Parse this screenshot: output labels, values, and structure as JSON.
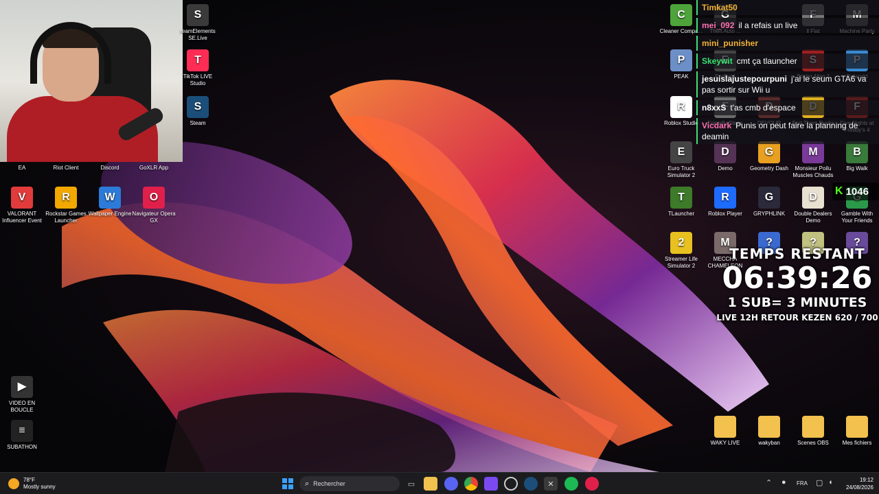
{
  "desktop_left": [
    {
      "label": "EA",
      "color": "#f0f0f0",
      "glyph": ""
    },
    {
      "label": "Riot Client",
      "color": "#f0f0f0",
      "glyph": ""
    },
    {
      "label": "Discord",
      "color": "#f0f0f0",
      "glyph": ""
    },
    {
      "label": "GoXLR App",
      "color": "#f0f0f0",
      "glyph": ""
    },
    {
      "label": "VALORANT Influencer Event",
      "color": "#e23b3b",
      "glyph": "V"
    },
    {
      "label": "Rockstar Games Launcher",
      "color": "#f2a800",
      "glyph": "R"
    },
    {
      "label": "Wallpaper Engine",
      "color": "#2c7bd9",
      "glyph": "W"
    },
    {
      "label": "Navigateur Opera GX",
      "color": "#e0204a",
      "glyph": "O"
    },
    {
      "label": "reamElements SE.Live",
      "color": "#3a3a3a",
      "glyph": "S"
    },
    {
      "label": "TikTok LIVE Studio",
      "color": "#ff2d55",
      "glyph": "T"
    },
    {
      "label": "Steam",
      "color": "#1b4f79",
      "glyph": "S"
    },
    {
      "label": "VIDEO EN BOUCLE",
      "color": "#333333",
      "glyph": "▶"
    },
    {
      "label": "SUBATHON",
      "color": "#222222",
      "glyph": "≡"
    }
  ],
  "desktop_right": [
    {
      "label": "Cleaner Compa...",
      "color": "#4ea43a",
      "glyph": "C"
    },
    {
      "label": "Theft Auto ...",
      "color": "#333333",
      "glyph": "G"
    },
    {
      "label": "ll Flat",
      "color": "#777777",
      "glyph": "F"
    },
    {
      "label": "Machine Party",
      "color": "#5a5a5a",
      "glyph": "M"
    },
    {
      "label": "PEAK",
      "color": "#6d8fc8",
      "glyph": "P"
    },
    {
      "label": "Endfield",
      "color": "#444444",
      "glyph": "E"
    },
    {
      "label": "Spider-Man 2",
      "color": "#a02020",
      "glyph": "S"
    },
    {
      "label": "Palworld",
      "color": "#3a8ad0",
      "glyph": "P"
    },
    {
      "label": "Roblox Studio",
      "color": "#ffffff",
      "glyph": "R"
    },
    {
      "label": "Friendly Steps",
      "color": "#6b6b6b",
      "glyph": "F"
    },
    {
      "label": "DEVOUR",
      "color": "#5a2a2a",
      "glyph": "D"
    },
    {
      "label": "Sort Them Ducks",
      "color": "#e0b020",
      "glyph": "D"
    },
    {
      "label": "Five Nights at Freddy's 4",
      "color": "#5a1a1a",
      "glyph": "F"
    },
    {
      "label": "Euro Truck Simulator 2",
      "color": "#444444",
      "glyph": "E"
    },
    {
      "label": "Demo",
      "color": "#553355",
      "glyph": "D"
    },
    {
      "label": "Geometry Dash",
      "color": "#e8a020",
      "glyph": "G"
    },
    {
      "label": "Monsieur Poilu Muscles Chauds",
      "color": "#7a3a9a",
      "glyph": "M"
    },
    {
      "label": "Big Walk",
      "color": "#3a7a3a",
      "glyph": "B"
    },
    {
      "label": "TLauncher",
      "color": "#3d7a2a",
      "glyph": "T"
    },
    {
      "label": "Roblox Player",
      "color": "#1e6bff",
      "glyph": "R"
    },
    {
      "label": "GRYPHLINK",
      "color": "#2a2a3a",
      "glyph": "G"
    },
    {
      "label": "Double Dealers Demo",
      "color": "#e8e0d0",
      "glyph": "D"
    },
    {
      "label": "Gamble With Your Friends",
      "color": "#2a9a4a",
      "glyph": "G"
    },
    {
      "label": "Streamer Life Simulator 2",
      "color": "#e8c020",
      "glyph": "2"
    },
    {
      "label": "MECCHA CHAMELEON",
      "color": "#7a6a6a",
      "glyph": "M"
    },
    {
      "label": "",
      "color": "#3a6ad0",
      "glyph": "?"
    },
    {
      "label": "",
      "color": "#c0c080",
      "glyph": "?"
    },
    {
      "label": "",
      "color": "#6a4a9a",
      "glyph": "?"
    }
  ],
  "desktop_folders": [
    {
      "label": "WAKY LIVE"
    },
    {
      "label": "wakyban"
    },
    {
      "label": "Scenes OBS"
    },
    {
      "label": "Mes fichiers"
    }
  ],
  "chat": [
    {
      "user": "Timkat50",
      "text": "",
      "color": "gold"
    },
    {
      "user": "mei_092",
      "text": "il a refais un live",
      "color": "pink"
    },
    {
      "user": "mini_punisher",
      "text": "",
      "color": "gold"
    },
    {
      "user": "Skeywit",
      "text": "cmt ça tlauncher",
      "color": "green"
    },
    {
      "user": "jesuislajustepourpuni",
      "text": "j'ai le seum GTA6 va pas sortir sur Wii u",
      "color": "white"
    },
    {
      "user": "n8xxS",
      "text": "t'as cmb d'espace",
      "color": "white"
    },
    {
      "user": "Vicdark",
      "text": "Punis on peut faire la planning de deamin",
      "color": "pink"
    }
  ],
  "kick_viewers": "1046",
  "timer": {
    "title": "TEMPS RESTANT",
    "time": "06:39:26",
    "rule": "1 SUB= 3 MINUTES",
    "goal": "LIVE 12H RETOUR KEZEN 620 / 700"
  },
  "taskbar": {
    "weather_temp": "78°F",
    "weather_desc": "Mostly sunny",
    "search_placeholder": "Rechercher",
    "language": "FRA",
    "time": "19:12",
    "date": "24/08/2026"
  }
}
